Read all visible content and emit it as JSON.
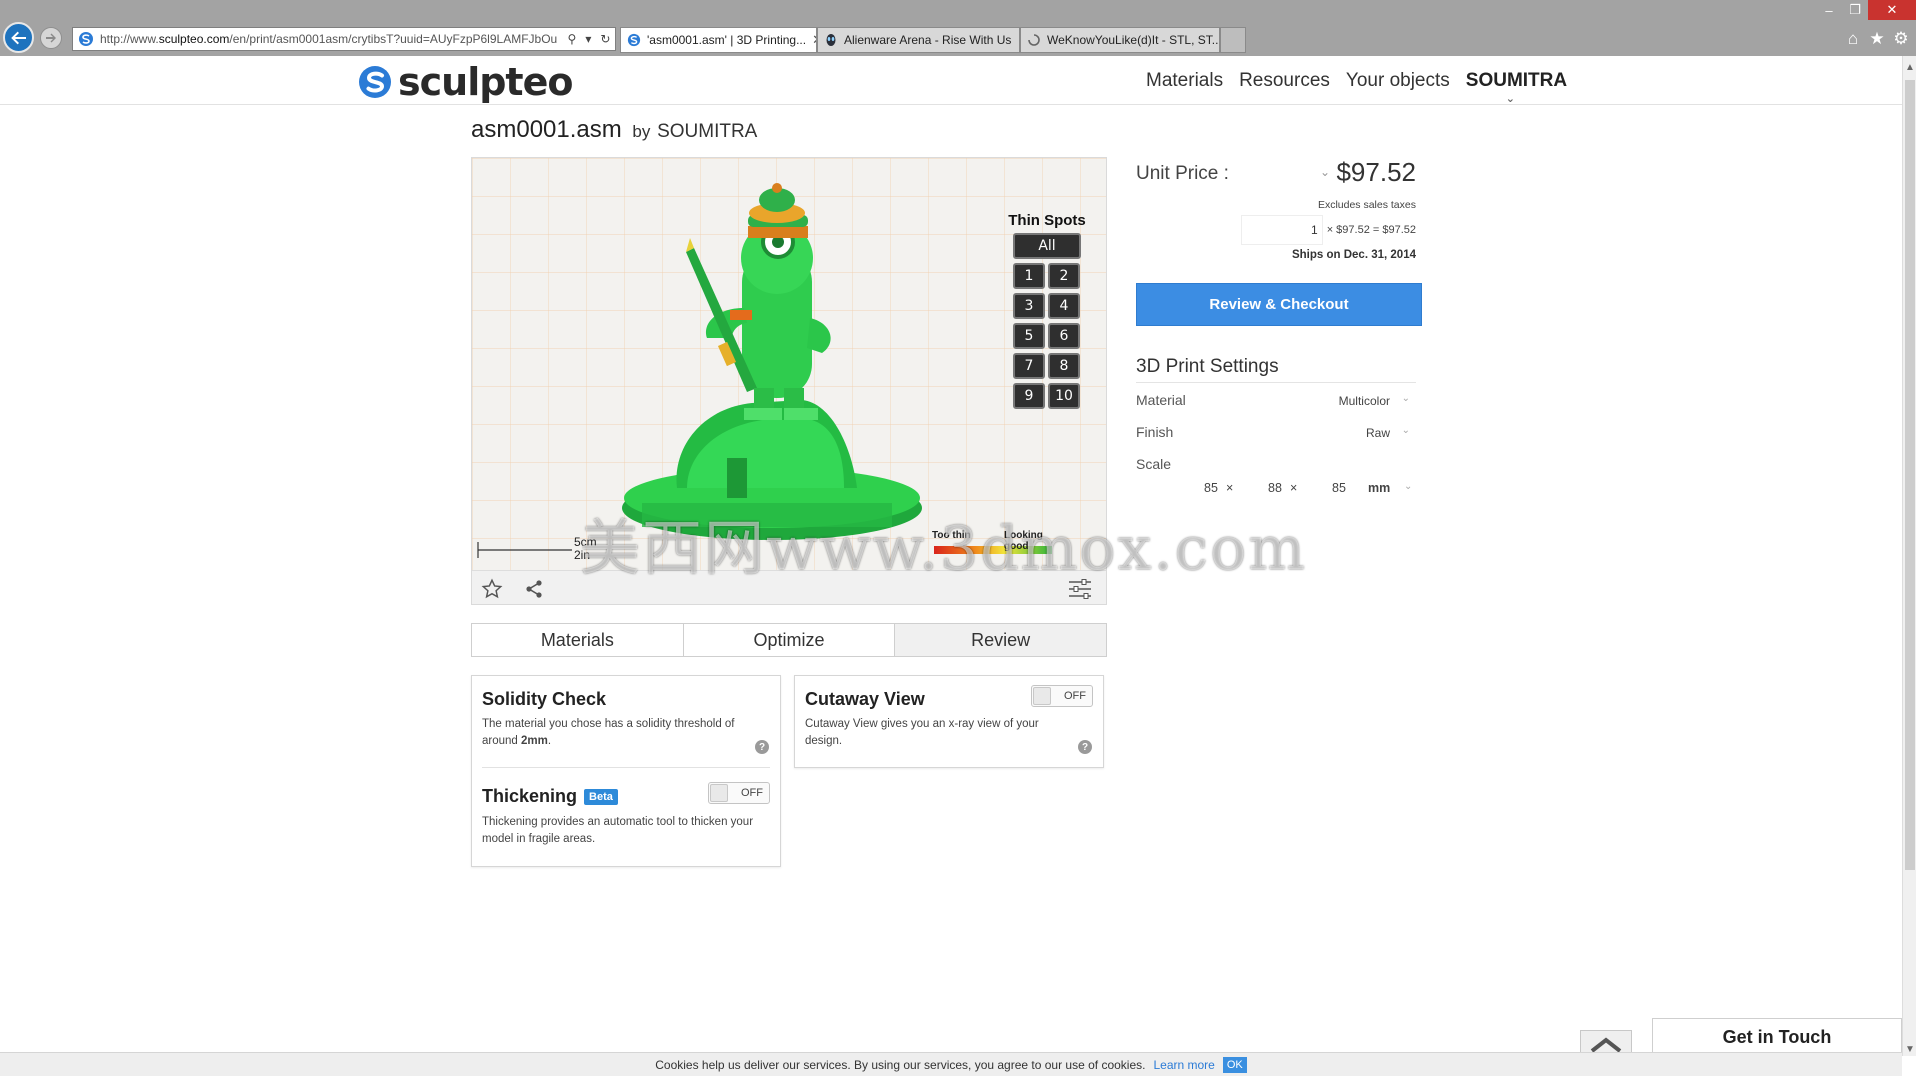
{
  "browser": {
    "url_prefix": "http://www.",
    "url_domain": "sculpteo.com",
    "url_rest": "/en/print/asm0001asm/crytibsT?uuid=AUyFzpP6l9LAMFJbOu",
    "tabs": [
      {
        "label": "'asm0001.asm' | 3D Printing...",
        "active": true
      },
      {
        "label": "Alienware Arena - Rise With Us",
        "active": false
      },
      {
        "label": "WeKnowYouLike(d)It - STL, ST...",
        "active": false
      }
    ]
  },
  "site": {
    "logo": "sculpteo",
    "nav": [
      "Materials",
      "Resources",
      "Your objects"
    ],
    "user": "SOUMITRA",
    "brand_color": "#2b7bd6"
  },
  "object": {
    "name": "asm0001.asm",
    "by": "by",
    "author": "SOUMITRA"
  },
  "viewer": {
    "thin_spots_title": "Thin Spots",
    "all_label": "All",
    "spots": [
      "1",
      "2",
      "3",
      "4",
      "5",
      "6",
      "7",
      "8",
      "9",
      "10"
    ],
    "scale_cm": "5cm",
    "scale_in": "2in",
    "legend_thin": "Too thin",
    "legend_good": "Looking good",
    "watermark": "美西网www.3dmox.com"
  },
  "tabs": [
    "Materials",
    "Optimize",
    "Review"
  ],
  "solidity": {
    "title": "Solidity Check",
    "text": "The material you chose has a solidity threshold of around ",
    "threshold": "2mm",
    "text_end": "."
  },
  "thickening": {
    "title": "Thickening",
    "badge": "Beta",
    "toggle": "OFF",
    "text": "Thickening provides an automatic tool to thicken your model in fragile areas."
  },
  "cutaway": {
    "title": "Cutaway View",
    "toggle": "OFF",
    "text": "Cutaway View gives you an x-ray view of your design."
  },
  "pricing": {
    "unit_price_label": "Unit Price :",
    "unit_price": "$97.52",
    "excl": "Excludes sales taxes",
    "qty": "1",
    "formula": "× $97.52 = $97.52",
    "ships": "Ships on Dec. 31, 2014",
    "checkout": "Review & Checkout"
  },
  "settings": {
    "title": "3D Print Settings",
    "material_label": "Material",
    "material": "Multicolor",
    "finish_label": "Finish",
    "finish": "Raw",
    "scale_label": "Scale",
    "x": "85",
    "y": "88",
    "z": "85",
    "times": "×",
    "unit": "mm"
  },
  "footer": {
    "get_in_touch": "Get in Touch",
    "cookie_text": "Cookies help us deliver our services. By using our services, you agree to our use of cookies.",
    "learn_more": "Learn more",
    "ok": "OK"
  }
}
